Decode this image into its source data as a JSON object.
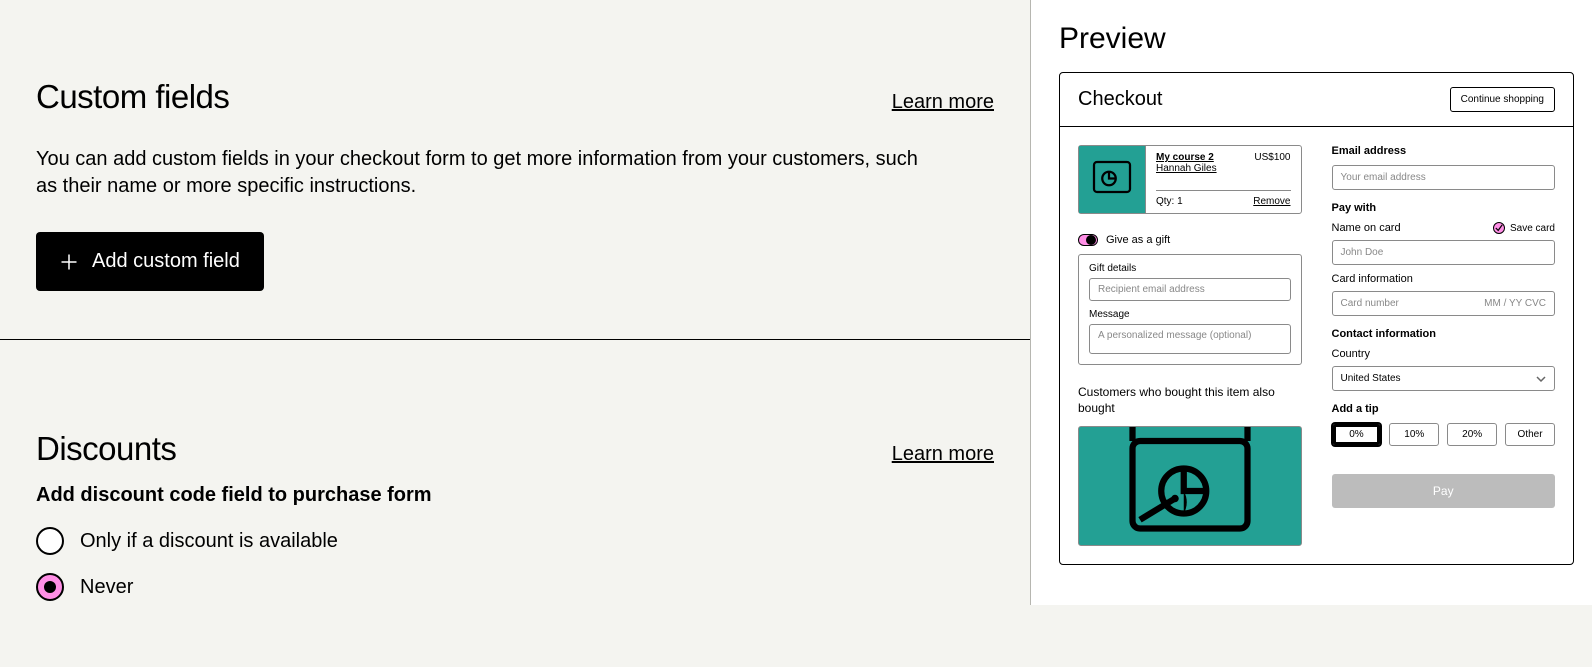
{
  "customFields": {
    "title": "Custom fields",
    "learnMore": "Learn more",
    "description": "You can add custom fields in your checkout form to get more information from your customers, such as their name or more specific instructions.",
    "addButton": "Add custom field"
  },
  "discounts": {
    "title": "Discounts",
    "learnMore": "Learn more",
    "heading": "Add discount code field to purchase form",
    "options": [
      {
        "label": "Only if a discount is available",
        "selected": false
      },
      {
        "label": "Never",
        "selected": true
      }
    ]
  },
  "preview": {
    "title": "Preview",
    "header": {
      "checkout": "Checkout",
      "continue": "Continue shopping"
    },
    "cart": {
      "productName": "My course 2",
      "seller": "Hannah Giles",
      "price": "US$100",
      "qtyLabel": "Qty: 1",
      "remove": "Remove"
    },
    "gift": {
      "toggleLabel": "Give as a gift",
      "detailsLabel": "Gift details",
      "recipientPlaceholder": "Recipient email address",
      "messageLabel": "Message",
      "messagePlaceholder": "A personalized message (optional)"
    },
    "recs": {
      "title": "Customers who bought this item also bought"
    },
    "email": {
      "heading": "Email address",
      "placeholder": "Your email address"
    },
    "payWith": {
      "heading": "Pay with",
      "nameLabel": "Name on card",
      "saveCard": "Save card",
      "namePlaceholder": "John Doe",
      "cardInfoLabel": "Card information",
      "cardPlaceholder": "Card number",
      "cardMeta": "MM / YY  CVC"
    },
    "contact": {
      "heading": "Contact information",
      "countryLabel": "Country",
      "country": "United States"
    },
    "tip": {
      "heading": "Add a tip",
      "options": [
        "0%",
        "10%",
        "20%",
        "Other"
      ],
      "selected": "0%"
    },
    "payButton": "Pay"
  }
}
